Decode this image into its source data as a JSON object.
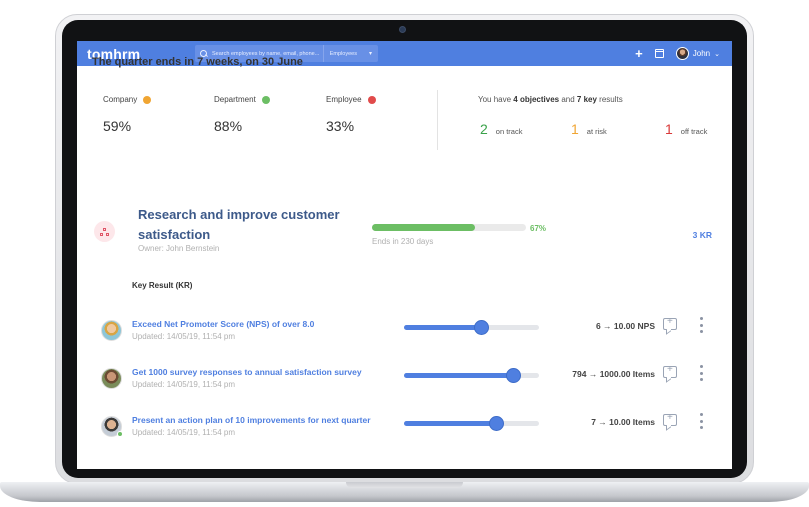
{
  "app": {
    "brand": "tomhrm"
  },
  "search": {
    "placeholder": "Search employees by name, email, phone...",
    "scope": "Employees"
  },
  "user": {
    "name": "John"
  },
  "quarter": {
    "text": "The quarter ends in 7 weeks, on 30 June"
  },
  "stats": [
    {
      "label": "Company",
      "value": "59%",
      "color": "#f0a532"
    },
    {
      "label": "Department",
      "value": "88%",
      "color": "#6cbe64"
    },
    {
      "label": "Employee",
      "value": "33%",
      "color": "#e14b4b"
    }
  ],
  "summary": {
    "prefix": "You have ",
    "objectives": "4 objectives",
    "and": " and ",
    "key_results": "7 key",
    "suffix": " results",
    "on_track": {
      "count": "2",
      "label": "on track",
      "color": "#3aa24a"
    },
    "at_risk": {
      "count": "1",
      "label": "at risk",
      "color": "#f0a532"
    },
    "off_track": {
      "count": "1",
      "label": "off track",
      "color": "#d93838"
    }
  },
  "objective": {
    "title": "Research and improve customer satisfaction",
    "owner": "Owner: John Bernstein",
    "progress_pct": "67%",
    "progress": 0.67,
    "ends": "Ends in 230 days",
    "kr_count": "3 KR",
    "icon": "sitemap-icon"
  },
  "key_results": {
    "heading": "Key Result (KR)",
    "items": [
      {
        "title": "Exceed Net Promoter Score (NPS) of over 8.0",
        "updated": "Updated: 14/05/19, 11:54 pm",
        "value": "6 → 10.00 NPS",
        "progress": 0.57,
        "online": false
      },
      {
        "title": "Get 1000 survey responses to annual satisfaction survey",
        "updated": "Updated: 14/05/19, 11:54 pm",
        "value": "794 → 1000.00 Items",
        "progress": 0.81,
        "online": false
      },
      {
        "title": "Present an action plan of 10 improvements for next quarter",
        "updated": "Updated: 14/05/19, 11:54 pm",
        "value": "7 → 10.00 Items",
        "progress": 0.68,
        "online": true
      }
    ]
  },
  "colors": {
    "primary": "#4f7fe0",
    "success": "#6cbe64",
    "title": "#3d5a8a"
  }
}
